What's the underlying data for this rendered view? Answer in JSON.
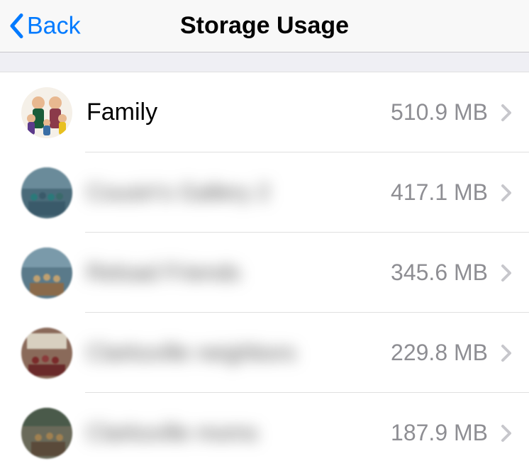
{
  "nav": {
    "back_label": "Back",
    "title": "Storage Usage"
  },
  "chats": [
    {
      "name": "Family",
      "size": "510.9 MB",
      "blurred": false
    },
    {
      "name": "Cousin's Gallery 2",
      "size": "417.1 MB",
      "blurred": true
    },
    {
      "name": "Reload Friends",
      "size": "345.6 MB",
      "blurred": true
    },
    {
      "name": "Clarksville neighbors",
      "size": "229.8 MB",
      "blurred": true
    },
    {
      "name": "Clarksville moms",
      "size": "187.9 MB",
      "blurred": true
    }
  ]
}
